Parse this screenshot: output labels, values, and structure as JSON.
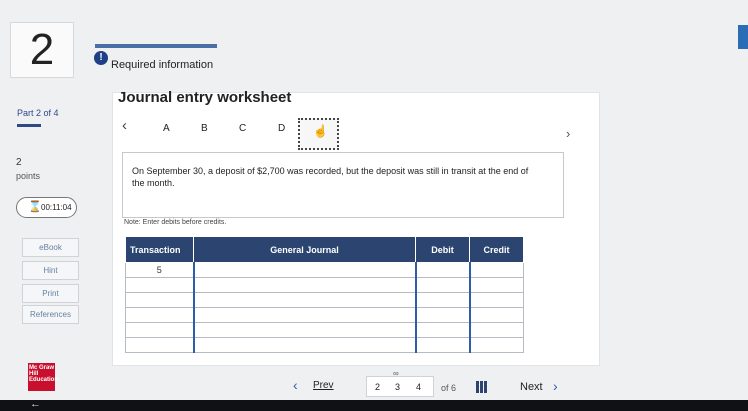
{
  "question": {
    "number": "2"
  },
  "required": {
    "icon": "!",
    "label": "Required information"
  },
  "meta": {
    "part": "Part 2 of 4",
    "points_value": "2",
    "points_label": "points",
    "timer": "00:11:04"
  },
  "side_buttons": [
    "eBook",
    "Hint",
    "Print",
    "References"
  ],
  "worksheet": {
    "title": "Journal entry worksheet",
    "tabs": [
      "A",
      "B",
      "C",
      "D"
    ],
    "description": "On September 30, a deposit of $2,700 was recorded, but the deposit was still in transit at the end of the month.",
    "note": "Note: Enter debits before credits.",
    "table": {
      "headers": [
        "Transaction",
        "General Journal",
        "Debit",
        "Credit"
      ],
      "rows": [
        [
          "5",
          "",
          "",
          ""
        ],
        [
          "",
          "",
          "",
          ""
        ],
        [
          "",
          "",
          "",
          ""
        ],
        [
          "",
          "",
          "",
          ""
        ],
        [
          "",
          "",
          "",
          ""
        ],
        [
          "",
          "",
          "",
          ""
        ]
      ]
    }
  },
  "logo": {
    "text": "Mc Graw Hill Education"
  },
  "pager": {
    "prev": "Prev",
    "pages": [
      "2",
      "3",
      "4"
    ],
    "of_label": "of 6",
    "next": "Next"
  },
  "icons": {
    "hourglass": "hourglass-icon",
    "nav_left": "chevron-left-icon",
    "nav_right": "chevron-right-icon",
    "hand": "hand-pointer-icon",
    "grid": "grid-icon",
    "link": "link-icon"
  }
}
